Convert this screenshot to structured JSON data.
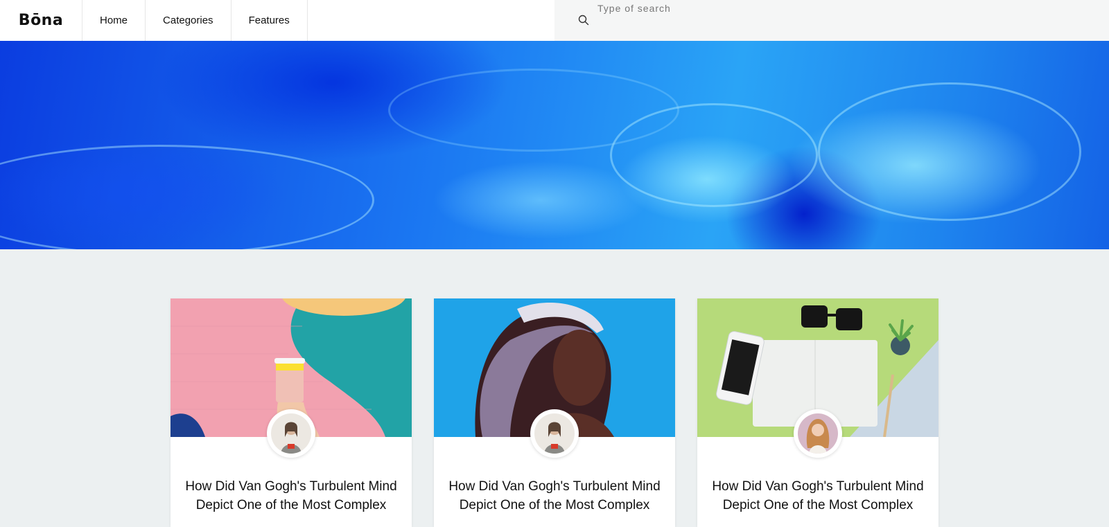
{
  "header": {
    "logo": "Bōna",
    "nav": [
      {
        "label": "Home"
      },
      {
        "label": "Categories"
      },
      {
        "label": "Features"
      }
    ],
    "search": {
      "placeholder": "Type of search",
      "value": ""
    }
  },
  "cards": [
    {
      "title": "How Did Van Gogh's Turbulent Mind Depict One of the Most Complex"
    },
    {
      "title": "How Did Van Gogh's Turbulent Mind Depict One of the Most Complex"
    },
    {
      "title": "How Did Van Gogh's Turbulent Mind Depict One of the Most Complex"
    }
  ],
  "colors": {
    "page_background": "#ecf0f1",
    "header_background": "#ffffff",
    "search_background": "#f5f6f6",
    "hero_primary": "#1b78f2"
  }
}
